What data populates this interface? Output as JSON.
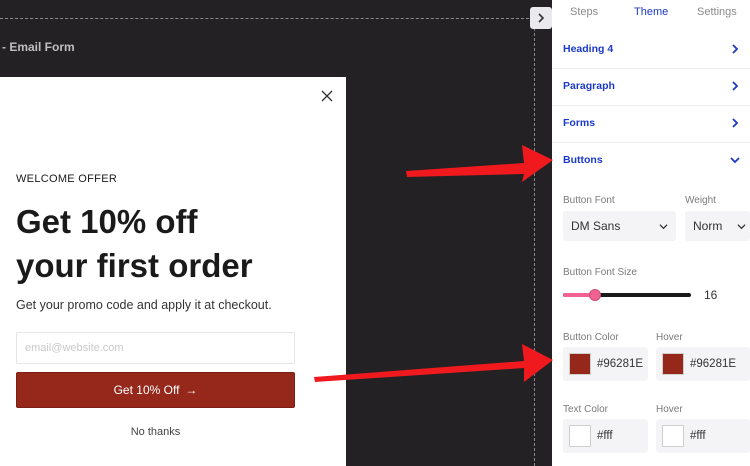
{
  "canvas": {
    "title": "- Email Form"
  },
  "popup": {
    "eyebrow": "WELCOME OFFER",
    "headline_line1": "Get 10% off",
    "headline_line2": "your first order",
    "subtext": "Get your promo code and apply it at checkout.",
    "email_placeholder": "email@website.com",
    "cta_label": "Get 10% Off",
    "cta_arrow": "→",
    "no_thanks": "No thanks"
  },
  "panel": {
    "tabs": [
      {
        "label": "Steps",
        "active": false
      },
      {
        "label": "Theme",
        "active": true
      },
      {
        "label": "Settings",
        "active": false
      }
    ],
    "sections": [
      {
        "label": "Heading 4",
        "expanded": false
      },
      {
        "label": "Paragraph",
        "expanded": false
      },
      {
        "label": "Forms",
        "expanded": false
      },
      {
        "label": "Buttons",
        "expanded": true
      }
    ],
    "button_font_label": "Button Font",
    "button_font_value": "DM Sans",
    "weight_label": "Weight",
    "weight_value": "Norm",
    "font_size_label": "Button Font Size",
    "font_size_value": "16",
    "font_size_level": 0.25,
    "button_color_label": "Button Color",
    "button_color_hover_label": "Hover",
    "button_color_value": "#96281E",
    "button_color_hover_value": "#96281E",
    "text_color_label": "Text Color",
    "text_color_hover_label": "Hover",
    "text_color_value": "#fff",
    "text_color_hover_value": "#fff"
  },
  "colors": {
    "canvas_bg": "#242124",
    "accent": "#1b39c7",
    "button": "#96281B",
    "slider": "#f06292",
    "annotation_arrow": "#f0191e"
  }
}
